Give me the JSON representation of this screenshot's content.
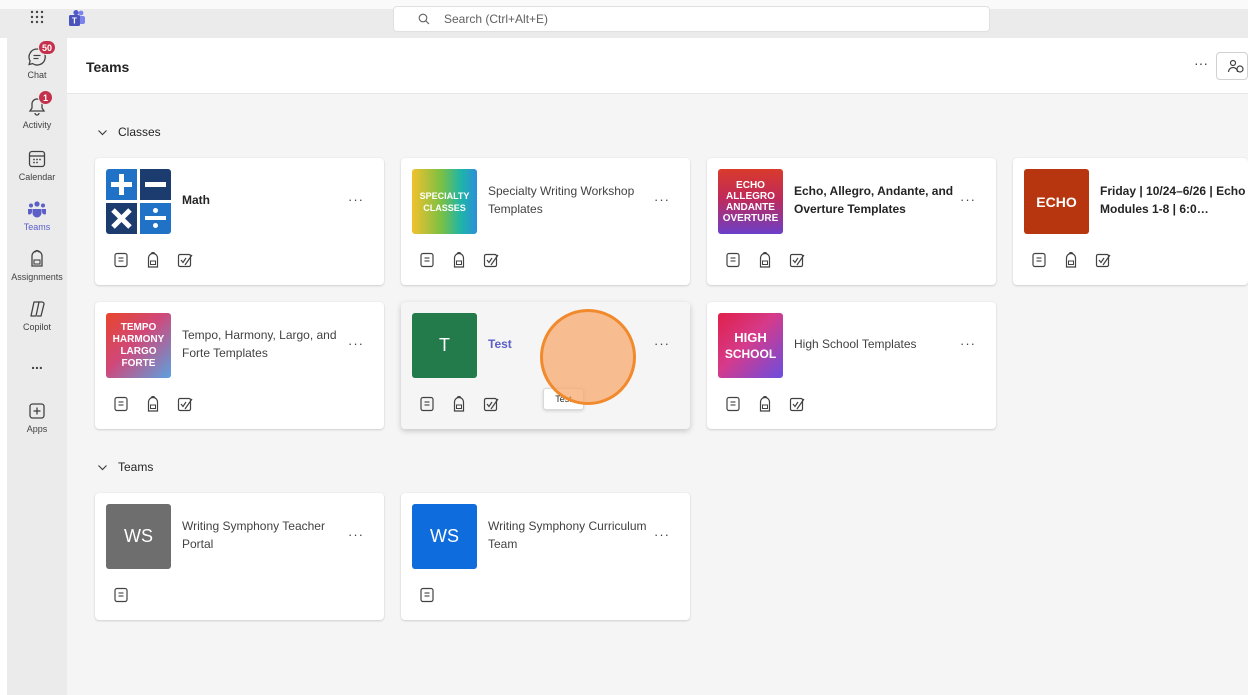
{
  "topbar": {
    "search_placeholder": "Search (Ctrl+Alt+E)",
    "apps_icon": "waffle-icon",
    "logo_icon": "teams-logo-icon"
  },
  "rail": {
    "items": [
      {
        "label": "Chat",
        "icon": "chat-icon",
        "badge": "50"
      },
      {
        "label": "Activity",
        "icon": "bell-icon",
        "badge": "1"
      },
      {
        "label": "Calendar",
        "icon": "calendar-icon",
        "badge": ""
      },
      {
        "label": "Teams",
        "icon": "teams-icon",
        "badge": ""
      },
      {
        "label": "Assignments",
        "icon": "backpack-icon",
        "badge": ""
      },
      {
        "label": "Copilot",
        "icon": "copilot-icon",
        "badge": ""
      },
      {
        "label": "...",
        "icon": "more-icon",
        "badge": ""
      },
      {
        "label": "Apps",
        "icon": "add-apps-icon",
        "badge": ""
      }
    ]
  },
  "header": {
    "title": "Teams",
    "more": "···"
  },
  "sections": {
    "classes": {
      "label": "Classes"
    },
    "teams": {
      "label": "Teams"
    }
  },
  "cards": {
    "math": {
      "name": "Math"
    },
    "specialty": {
      "name": "Specialty Writing Workshop Templates",
      "thumb_text": "SPECIALTY CLASSES"
    },
    "echo_templates": {
      "name": "Echo, Allegro, Andante, and Overture Templates",
      "thumb_lines": [
        "ECHO",
        "ALLEGRO",
        "ANDANTE",
        "OVERTURE"
      ]
    },
    "friday": {
      "name": "Friday | 10/24–6/26 | Echo Modules 1-8 | 6:0…",
      "thumb_text": "ECHO"
    },
    "tempo": {
      "name": "Tempo, Harmony, Largo, and Forte Templates",
      "thumb_lines": [
        "TEMPO",
        "HARMONY",
        "LARGO",
        "FORTE"
      ]
    },
    "test": {
      "name": "Test",
      "thumb_text": "T",
      "tooltip": "Test"
    },
    "high_school": {
      "name": "High School Templates",
      "thumb_lines": [
        "HIGH",
        "SCHOOL"
      ]
    },
    "ws_portal": {
      "name": "Writing Symphony Teacher Portal",
      "thumb_text": "WS"
    },
    "ws_curriculum": {
      "name": "Writing Symphony Curriculum Team",
      "thumb_text": "WS"
    }
  },
  "card_more_label": "···",
  "colors": {
    "accent": "#5b5fc7",
    "badge": "#c4314b",
    "test_thumb": "#237b4b",
    "ws_portal_thumb": "#6e6e6e",
    "ws_curriculum_thumb": "#0f6cdd",
    "echo_thumb": "#b7360f",
    "click_marker": "#f08a2c"
  }
}
